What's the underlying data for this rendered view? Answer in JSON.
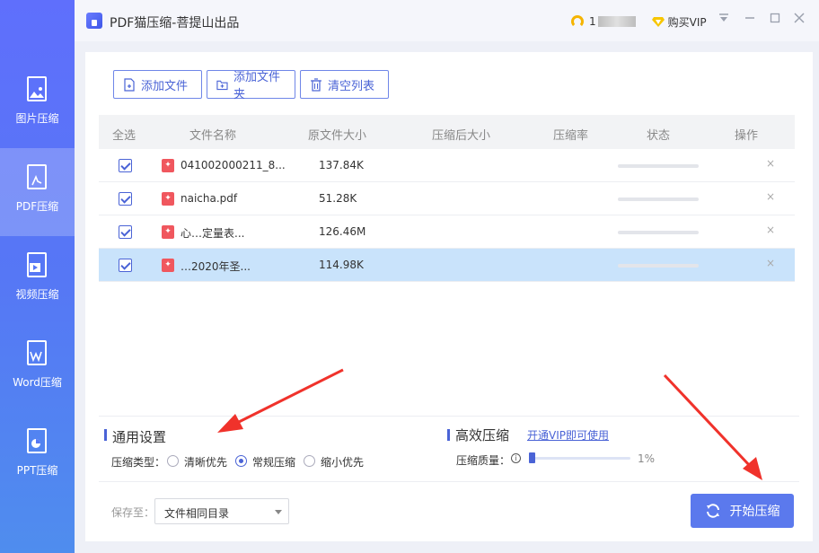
{
  "app": {
    "title": "PDF猫压缩-菩提山出品"
  },
  "user": {
    "name": "1",
    "vip_label": "购买VIP"
  },
  "sidebar": {
    "items": [
      {
        "label": "图片压缩",
        "icon": "image-file-icon"
      },
      {
        "label": "PDF压缩",
        "icon": "pdf-file-icon"
      },
      {
        "label": "视频压缩",
        "icon": "video-file-icon"
      },
      {
        "label": "Word压缩",
        "icon": "word-file-icon"
      },
      {
        "label": "PPT压缩",
        "icon": "ppt-file-icon"
      }
    ]
  },
  "toolbar": {
    "add_file": "添加文件",
    "add_folder": "添加文件夹",
    "clear_list": "清空列表"
  },
  "table": {
    "headers": {
      "select_all": "全选",
      "name": "文件名称",
      "orig_size": "原文件大小",
      "comp_size": "压缩后大小",
      "ratio": "压缩率",
      "status": "状态",
      "action": "操作"
    },
    "rows": [
      {
        "name": "041002000211_8...",
        "size": "137.84K",
        "progress": 0
      },
      {
        "name": "naicha.pdf",
        "size": "51.28K",
        "progress": 0
      },
      {
        "name": "心…定量表...",
        "size": "126.46M",
        "progress": 0
      },
      {
        "name": "…2020年圣...",
        "size": "114.98K",
        "progress": 0
      }
    ],
    "delete_symbol": "×"
  },
  "settings": {
    "general_title": "通用设置",
    "type_label": "压缩类型：",
    "options": [
      "清晰优先",
      "常规压缩",
      "缩小优先"
    ],
    "selected_option": "常规压缩",
    "efficient_title": "高效压缩",
    "vip_link": "开通VIP即可使用",
    "quality_label": "压缩质量：",
    "quality_value": "1%",
    "quality_fraction": 0.01
  },
  "footer": {
    "save_label": "保存至：",
    "save_value": "文件相同目录",
    "start_label": "开始压缩"
  },
  "colors": {
    "accent": "#4a63d6",
    "sidebar_top": "#5f6ffc",
    "sidebar_bottom": "#4f8dee",
    "row_selected": "#c9e3fb",
    "pdf_red": "#f0575e",
    "arrow_red": "#f0322b"
  }
}
